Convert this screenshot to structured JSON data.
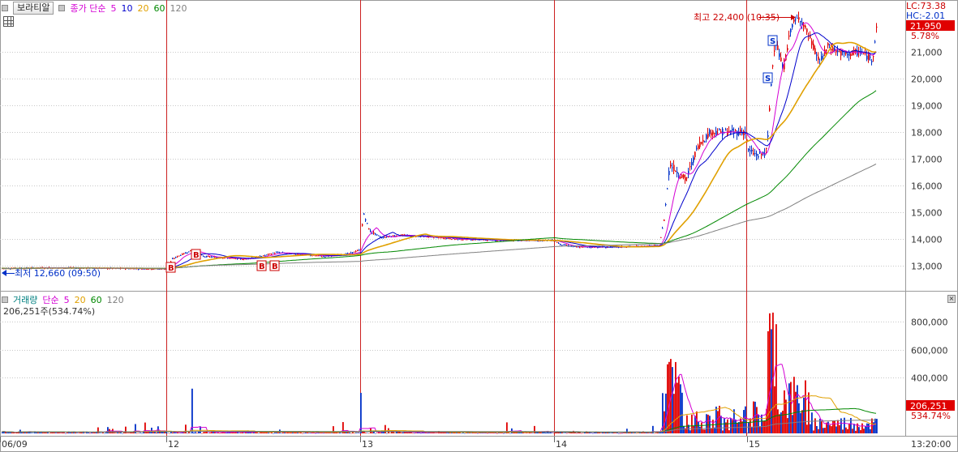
{
  "price_panel": {
    "stock_name": "보라티알",
    "ma_label": "종가 단순",
    "ma_periods": [
      {
        "label": "5",
        "color": "#d400d4"
      },
      {
        "label": "10",
        "color": "#0000cc"
      },
      {
        "label": "20",
        "color": "#e0a000"
      },
      {
        "label": "60",
        "color": "#008800"
      },
      {
        "label": "120",
        "color": "#808080"
      }
    ],
    "lc_text": "LC:73.38",
    "hc_text": "HC:-2.01",
    "high_annotation": "최고 22,400 (10:35)",
    "low_annotation": "최저 12,660 (09:50)",
    "current_price": "21,950",
    "change_pct": "5.78%",
    "y_ticks": [
      "21,000",
      "20,000",
      "19,000",
      "18,000",
      "17,000",
      "16,000",
      "15,000",
      "14,000",
      "13,000"
    ],
    "signal_marker_labels": {
      "buy": "B",
      "sell": "S"
    }
  },
  "volume_panel": {
    "label": "거래량",
    "ma_label": "단순",
    "ma_periods": [
      {
        "label": "5",
        "color": "#d400d4"
      },
      {
        "label": "20",
        "color": "#e0a000"
      },
      {
        "label": "60",
        "color": "#008800"
      },
      {
        "label": "120",
        "color": "#808080"
      }
    ],
    "current_text": "206,251주(534.74%)",
    "current_volume": "206,251",
    "current_pct": "534.74%",
    "y_ticks": [
      "800,000",
      "600,000",
      "400,000"
    ]
  },
  "x_axis": {
    "labels": [
      "06/09",
      "12",
      "13",
      "14",
      "15"
    ],
    "time_label": "13:20:00"
  },
  "colors": {
    "up": "#e00000",
    "down": "#0030c8",
    "separator": "#cc2020",
    "ma5": "#d400d4",
    "ma10": "#0000cc",
    "ma20": "#e0a000",
    "ma60": "#008800",
    "ma120": "#808080"
  },
  "chart_data": [
    {
      "type": "line",
      "title": "보라티알",
      "x": [
        "06/09",
        "12",
        "13",
        "14",
        "15"
      ],
      "series": [
        {
          "name": "종가",
          "values": [
            12900,
            13300,
            13900,
            13700,
            21950
          ]
        }
      ],
      "ylim": [
        12500,
        22500
      ],
      "high": 22400,
      "low": 12660,
      "current": 21950,
      "change_pct": 5.78
    },
    {
      "type": "bar",
      "title": "거래량",
      "x": [
        "06/09",
        "12",
        "13",
        "14",
        "15"
      ],
      "series": [
        {
          "name": "거래량",
          "values": [
            20000,
            300000,
            310000,
            510000,
            930000
          ]
        }
      ],
      "ylim": [
        0,
        950000
      ],
      "current": 206251,
      "current_pct": 534.74
    }
  ]
}
